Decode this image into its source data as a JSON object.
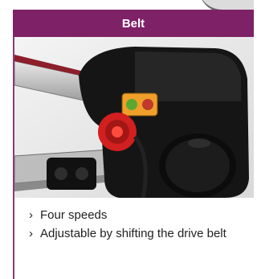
{
  "header": {
    "title": "Belt"
  },
  "photo": {
    "subject": "belt drive housing with switch",
    "icon": "machine-photo"
  },
  "features": {
    "marker": "›",
    "items": [
      "Four speeds",
      "Adjustable by shifting the drive belt"
    ]
  },
  "colors": {
    "header_bg": "#7e2166",
    "header_text": "#ffffff",
    "border": "#8a3a78",
    "switch_red": "#d21f1f",
    "switch_green": "#5aa832",
    "switch_amber": "#e2a02e"
  }
}
